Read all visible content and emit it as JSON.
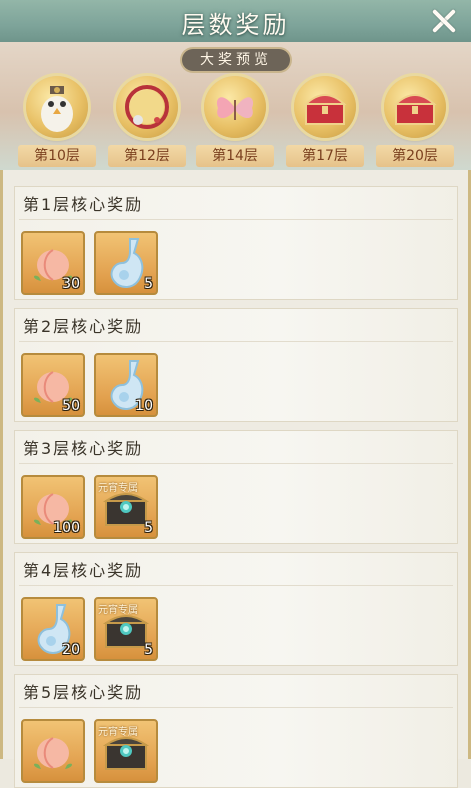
{
  "header": {
    "title": "层数奖励"
  },
  "preview": {
    "tag": "大奖预览",
    "items": [
      {
        "label": "第10层",
        "icon": "owl-avatar-icon"
      },
      {
        "label": "第12层",
        "icon": "ring-frame-icon"
      },
      {
        "label": "第14层",
        "icon": "pink-butterfly-icon"
      },
      {
        "label": "第17层",
        "icon": "red-chest-icon"
      },
      {
        "label": "第20层",
        "icon": "red-chest-icon"
      }
    ]
  },
  "cards": [
    {
      "title": "第1层核心奖励",
      "rewards": [
        {
          "icon": "peach-icon",
          "count": "30"
        },
        {
          "icon": "water-gourd-icon",
          "count": "5"
        }
      ]
    },
    {
      "title": "第2层核心奖励",
      "rewards": [
        {
          "icon": "peach-icon",
          "count": "50"
        },
        {
          "icon": "water-gourd-icon",
          "count": "10"
        }
      ]
    },
    {
      "title": "第3层核心奖励",
      "rewards": [
        {
          "icon": "peach-icon",
          "count": "100"
        },
        {
          "icon": "dark-chest-icon",
          "count": "5",
          "ribbon": "元宵专属"
        }
      ]
    },
    {
      "title": "第4层核心奖励",
      "rewards": [
        {
          "icon": "water-gourd-icon",
          "count": "20"
        },
        {
          "icon": "dark-chest-icon",
          "count": "5",
          "ribbon": "元宵专属"
        }
      ]
    },
    {
      "title": "第5层核心奖励",
      "rewards": [
        {
          "icon": "peach-icon",
          "count": ""
        },
        {
          "icon": "dark-chest-icon",
          "count": "",
          "ribbon": "元宵专属"
        }
      ]
    }
  ]
}
